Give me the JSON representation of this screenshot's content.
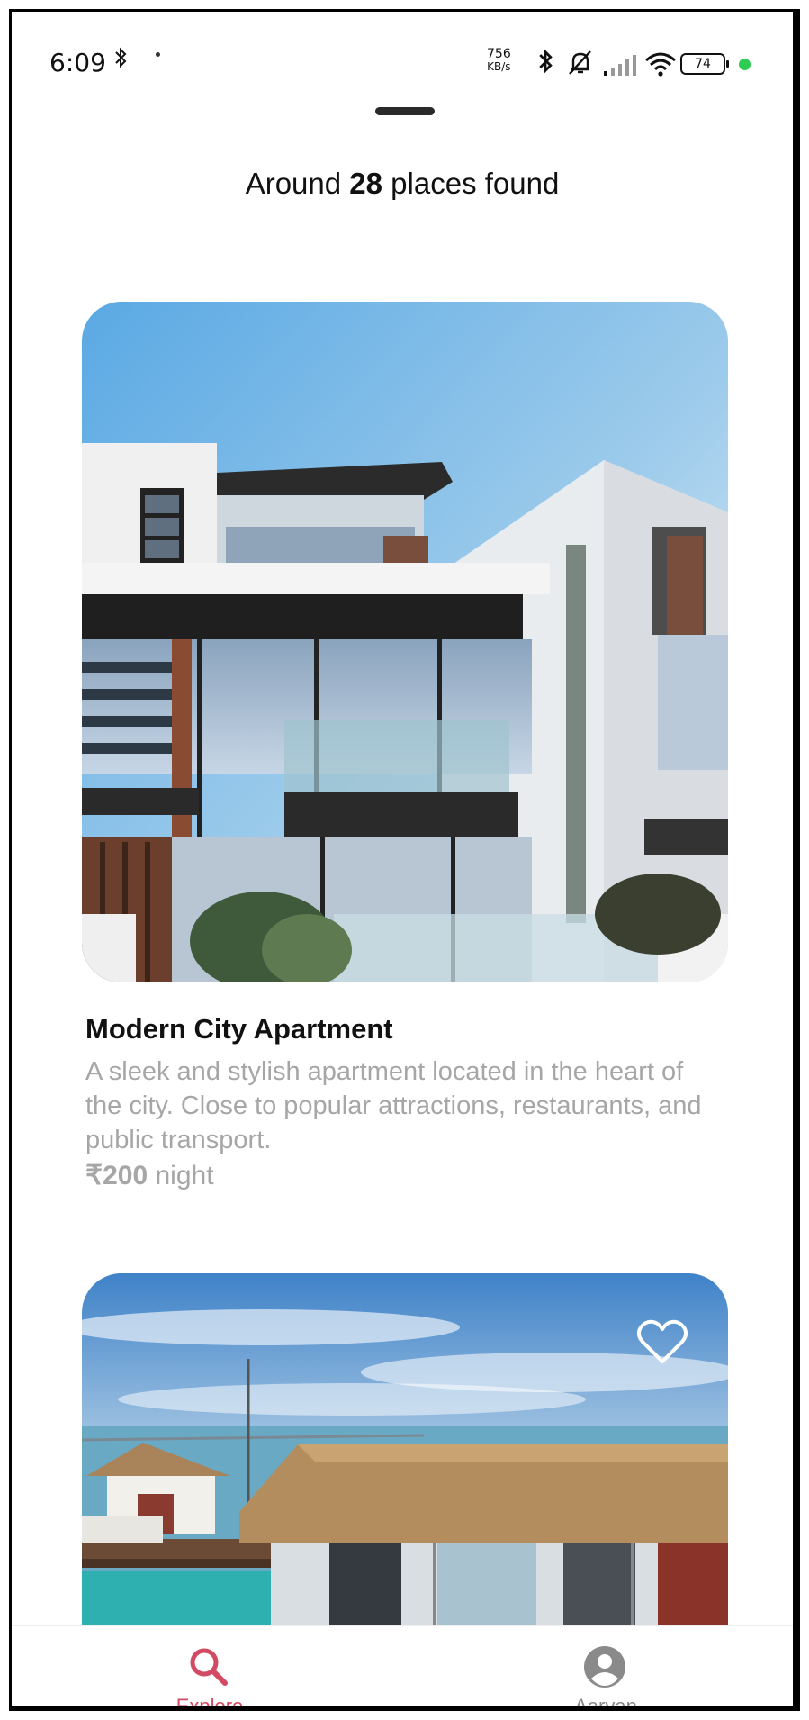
{
  "status_bar": {
    "time": "6:09",
    "net_speed_value": "756",
    "net_speed_unit": "KB/s",
    "battery": "74",
    "icons": [
      "bluetooth-icon",
      "mute-bell-icon",
      "signal-icon",
      "wifi-icon",
      "battery-icon"
    ]
  },
  "header": {
    "prefix": "Around",
    "count": "28",
    "suffix": "places found"
  },
  "listings": [
    {
      "title": "Modern City Apartment",
      "description": "A sleek and stylish apartment located in the heart of the city. Close to popular attractions, restaurants, and public transport.",
      "price": "₹200",
      "price_unit": "night",
      "favorite_visible": false
    },
    {
      "title": "",
      "favorite_visible": true
    }
  ],
  "bottom_nav": {
    "items": [
      {
        "label": "Explore",
        "icon": "search-icon",
        "active": true
      },
      {
        "label": "Aaryan",
        "icon": "account-circle-icon",
        "active": false
      }
    ]
  },
  "colors": {
    "accent": "#d24b63",
    "muted_text": "#a6a6a6",
    "status_green": "#2ecc52"
  }
}
